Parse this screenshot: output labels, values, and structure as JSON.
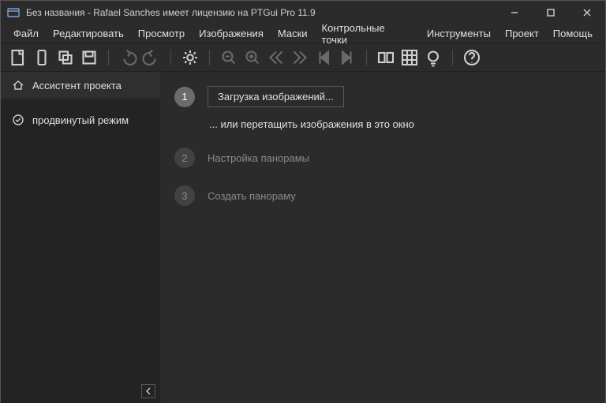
{
  "window": {
    "title": "Без названия - Rafael Sanches имеет лицензию на PTGui Pro 11.9"
  },
  "menu": {
    "items": [
      "Файл",
      "Редактировать",
      "Просмотр",
      "Изображения",
      "Маски",
      "Контрольные точки",
      "Инструменты",
      "Проект",
      "Помощь"
    ]
  },
  "sidebar": {
    "items": [
      {
        "label": "Ассистент проекта"
      },
      {
        "label": "продвинутый режим"
      }
    ]
  },
  "steps": {
    "s1": {
      "num": "1",
      "button": "Загрузка изображений...",
      "hint": "... или перетащить изображения в это окно"
    },
    "s2": {
      "num": "2",
      "label": "Настройка панорамы"
    },
    "s3": {
      "num": "3",
      "label": "Создать панораму"
    }
  }
}
